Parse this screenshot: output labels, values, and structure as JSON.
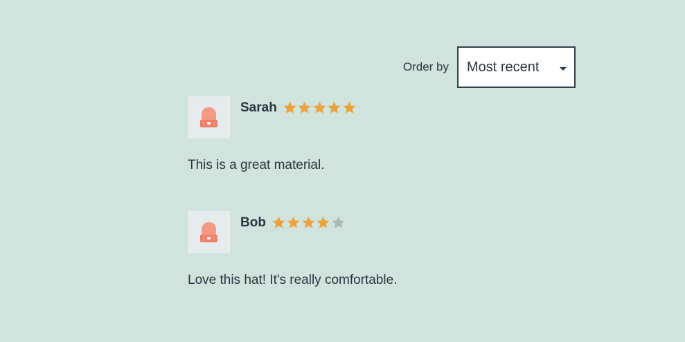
{
  "sort": {
    "label": "Order by",
    "selected": "Most recent",
    "caret_icon": "caret-down-icon"
  },
  "colors": {
    "background": "#d0e3dd",
    "star_filled": "#eda13a",
    "star_empty": "#a9b8b7",
    "text": "#2b3640"
  },
  "reviews": [
    {
      "name": "Sarah",
      "rating": 5,
      "max_rating": 5,
      "text": "This is a great material.",
      "avatar_icon": "beanie-hat-icon"
    },
    {
      "name": "Bob",
      "rating": 4,
      "max_rating": 5,
      "text": "Love this hat! It's really comfortable.",
      "avatar_icon": "beanie-hat-icon"
    }
  ]
}
